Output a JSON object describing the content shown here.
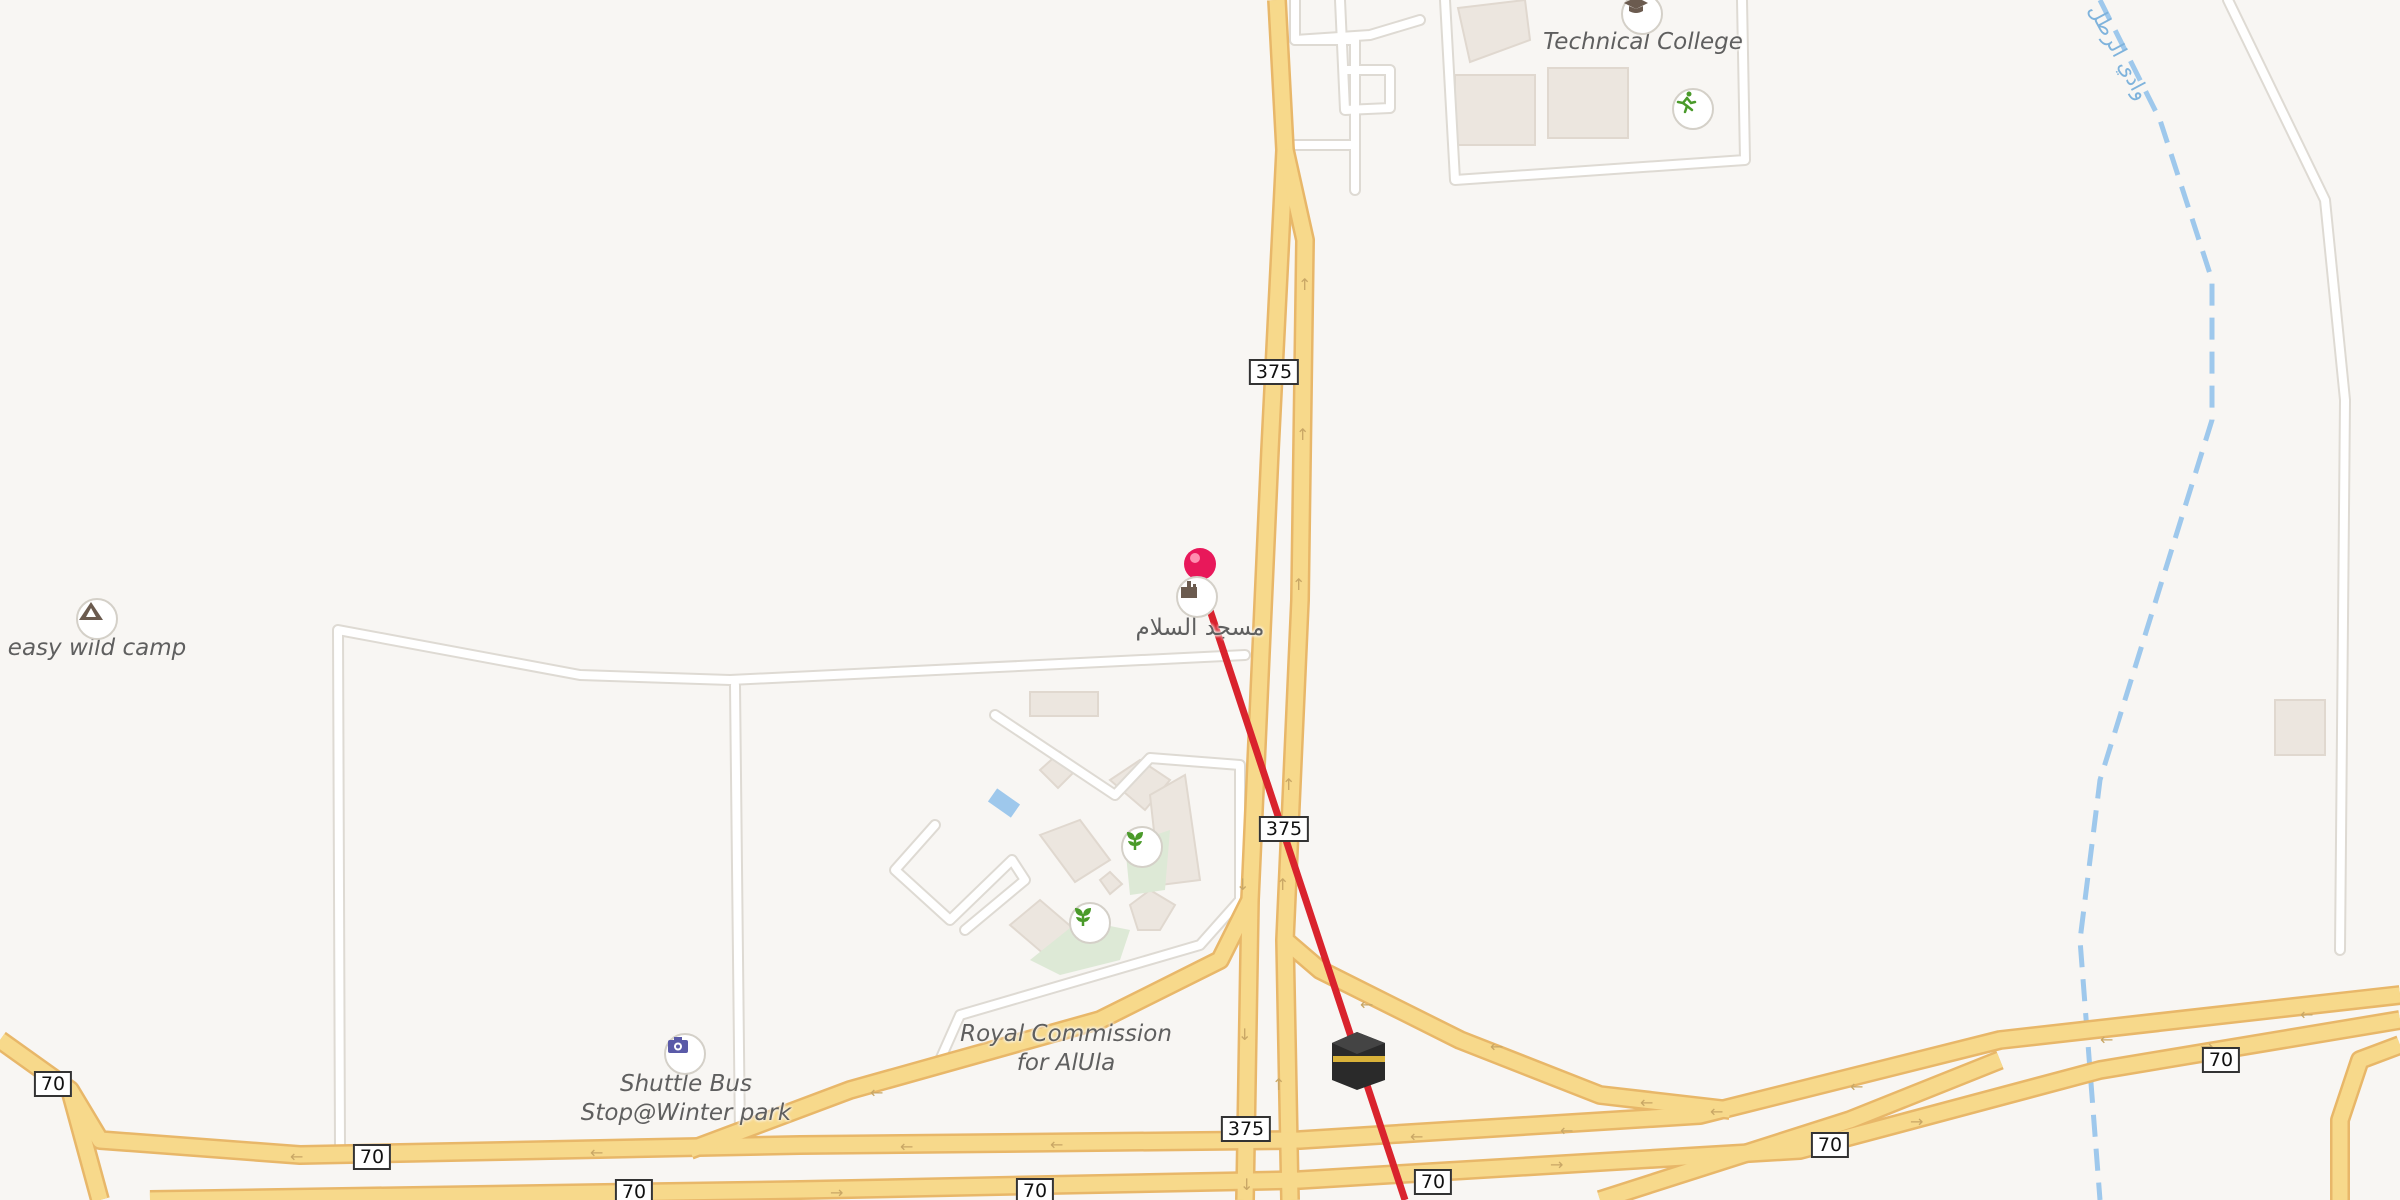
{
  "map": {
    "labels": {
      "technical_college": "Technical College",
      "mosque": "مسجد السلام",
      "easy_wild_camp": "easy wild camp",
      "shuttle_bus": "Shuttle Bus\nStop@Winter park",
      "royal_commission": "Royal Commission\nfor AlUla",
      "wadi": "وادي الرطل"
    },
    "road_shields": {
      "r375_a": "375",
      "r375_b": "375",
      "r375_c": "375",
      "r70_a": "70",
      "r70_b": "70",
      "r70_c": "70",
      "r70_d": "70",
      "r70_e": "70",
      "r70_f": "70",
      "r70_g": "70"
    },
    "icons": {
      "college": "graduation-cap-icon",
      "sports": "running-icon",
      "camp": "campsite-icon",
      "mosque": "mosque-icon",
      "camera": "camera-icon",
      "garden": "plant-icon",
      "kaaba": "kaaba-icon",
      "pin": "location-pin-icon"
    },
    "colors": {
      "background": "#f8f6f3",
      "road_major": "#f7d98b",
      "road_casing": "#e8b769",
      "route_line": "#d9232d",
      "pin": "#e8185a",
      "water": "#9ec8ec"
    }
  }
}
